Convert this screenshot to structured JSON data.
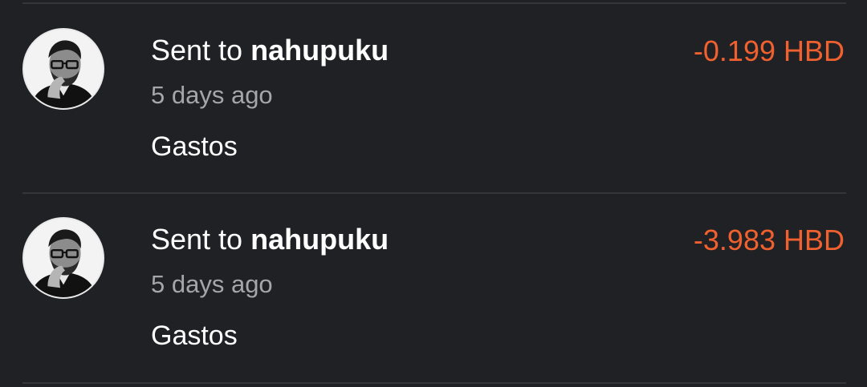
{
  "transactions": [
    {
      "prefix": "Sent to",
      "user": "nahupuku",
      "time": "5 days ago",
      "memo": "Gastos",
      "amount": "-0.199 HBD",
      "avatar_icon": "user-avatar-icon"
    },
    {
      "prefix": "Sent to",
      "user": "nahupuku",
      "time": "5 days ago",
      "memo": "Gastos",
      "amount": "-3.983 HBD",
      "avatar_icon": "user-avatar-icon"
    }
  ],
  "colors": {
    "background": "#1f2124",
    "divider": "#33363a",
    "primary_text": "#ffffff",
    "secondary_text": "#a3a6aa",
    "amount_negative": "#f0612f"
  }
}
